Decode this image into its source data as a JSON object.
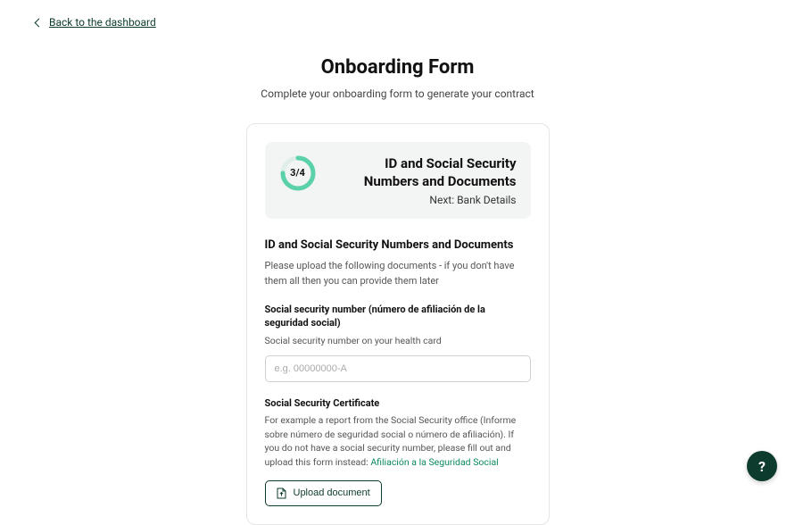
{
  "nav": {
    "back_label": "Back to the dashboard"
  },
  "header": {
    "title": "Onboarding Form",
    "subtitle": "Complete your onboarding form to generate your contract"
  },
  "progress": {
    "step_label": "3/4",
    "current_step": 3,
    "total_steps": 4,
    "heading": "ID and Social Security Numbers and Documents",
    "next_label": "Next: Bank Details"
  },
  "section": {
    "title": "ID and Social Security Numbers and Documents",
    "description": "Please upload the following documents - if you don't have them all then you can provide them later"
  },
  "fields": {
    "ssn": {
      "label": "Social security number (número de afiliación de la seguridad social)",
      "help": "Social security number on your health card",
      "placeholder": "e.g. 00000000-A"
    },
    "ssc": {
      "label": "Social Security Certificate",
      "help_prefix": "For example a report from the Social Security office (Informe sobre número de seguridad social o número de afiliación). If you do not have a social security number, please fill out and upload this form instead: ",
      "link_text": "Afiliación a la Seguridad Social",
      "upload_label": "Upload document"
    }
  },
  "colors": {
    "accent": "#5bd1a9",
    "ring_bg": "#dfeee8",
    "brand_dark": "#0d3b2e",
    "link_green": "#0d8a5e"
  }
}
